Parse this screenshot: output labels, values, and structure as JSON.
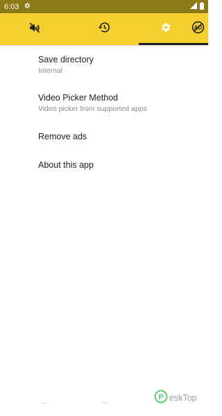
{
  "status_bar": {
    "time": "6:03",
    "icons": [
      "settings-gear-icon",
      "signal-icon",
      "battery-icon"
    ]
  },
  "tabs": [
    {
      "icon": "mute-icon",
      "selected": false
    },
    {
      "icon": "history-icon",
      "selected": false
    },
    {
      "icon": "settings-icon",
      "selected": true
    },
    {
      "icon": "remove-ads-icon",
      "label": "AD",
      "selected": false
    }
  ],
  "settings": {
    "save_directory": {
      "title": "Save directory",
      "summary": "Internal"
    },
    "video_picker": {
      "title": "Video Picker Method",
      "summary": "Video picker from supported apps"
    },
    "remove_ads": {
      "title": "Remove ads"
    },
    "about": {
      "title": "About this app"
    }
  },
  "watermark": {
    "prefix": "P",
    "text": "eskTop"
  },
  "colors": {
    "status_bar": "#8c7a16",
    "tab_bar": "#f5cf2e",
    "indicator": "#212121",
    "summary_text": "#8a8a8a"
  }
}
